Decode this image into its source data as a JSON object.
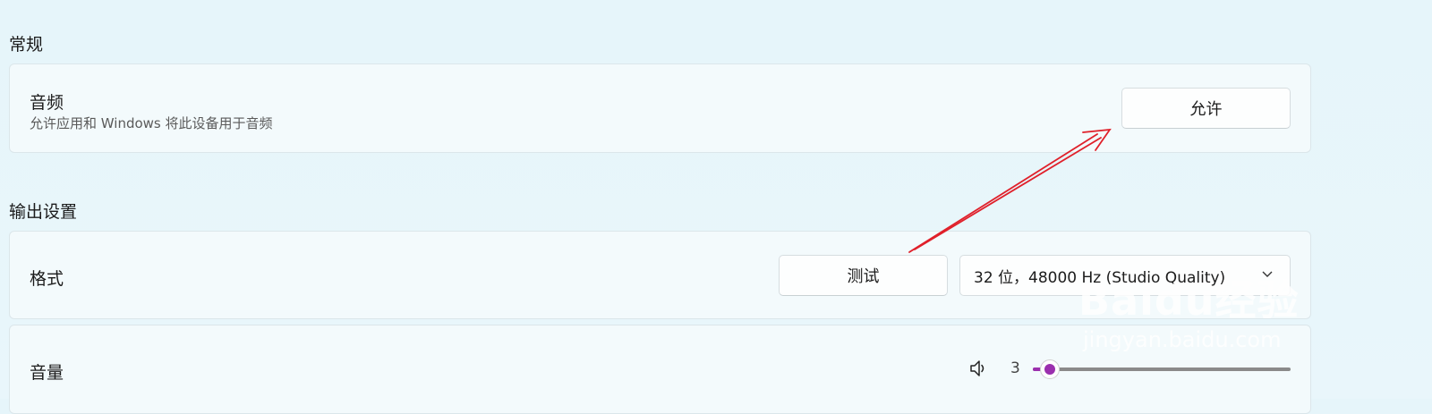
{
  "sections": {
    "general_title": "常规",
    "output_title": "输出设置"
  },
  "audio": {
    "title": "音频",
    "description": "允许应用和 Windows 将此设备用于音频",
    "allow_button": "允许"
  },
  "format": {
    "title": "格式",
    "test_button": "测试",
    "selected": "32 位，48000 Hz (Studio Quality)"
  },
  "volume": {
    "title": "音量",
    "value": "3",
    "level": 3,
    "max": 100,
    "accent_color": "#9b2fae"
  },
  "annotation": {
    "color": "#e0202a"
  },
  "watermark": {
    "logo_text": "Baidu经验",
    "url": "jingyan.baidu.com"
  }
}
